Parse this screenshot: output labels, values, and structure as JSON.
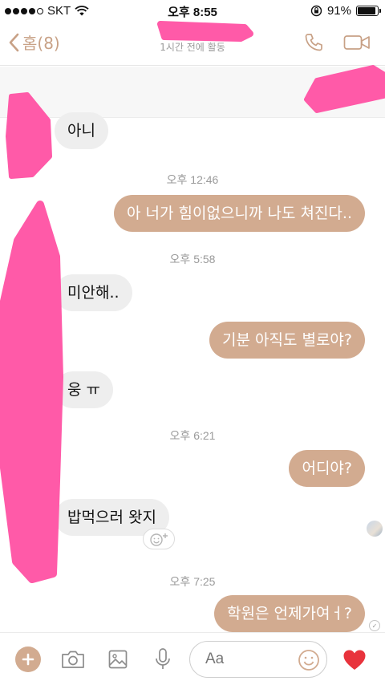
{
  "status_bar": {
    "carrier": "SKT",
    "time": "오후 8:55",
    "battery": "91%",
    "battery_level": 0.91
  },
  "nav": {
    "back_label": "홈(8)",
    "subtitle": "1시간 전에 활동"
  },
  "messages": [
    {
      "type": "incoming",
      "text": "아니"
    },
    {
      "type": "timestamp",
      "text": "오후 12:46"
    },
    {
      "type": "outgoing",
      "text": "아 너가 힘이없으니까 나도 쳐진다.."
    },
    {
      "type": "timestamp",
      "text": "오후 5:58"
    },
    {
      "type": "incoming",
      "text": "미안해.."
    },
    {
      "type": "outgoing",
      "text": "기분 아직도 별로야?"
    },
    {
      "type": "incoming",
      "text": "웅 ㅠ"
    },
    {
      "type": "timestamp",
      "text": "오후 6:21"
    },
    {
      "type": "outgoing",
      "text": "어디야?"
    },
    {
      "type": "incoming",
      "text": "밥먹으러 왓지"
    },
    {
      "type": "timestamp",
      "text": "오후 7:25"
    },
    {
      "type": "outgoing",
      "text": "학원은 언제가여ㅓ?"
    }
  ],
  "composer": {
    "placeholder": "Aa"
  },
  "colors": {
    "accent": "#d2ab90",
    "incoming_bubble": "#eeeeee",
    "redaction": "#ff5aa8",
    "like_heart": "#e8333c"
  },
  "icons": [
    "signal-dots-icon",
    "wifi-icon",
    "lock-rotation-icon",
    "battery-icon",
    "back-chevron-icon",
    "phone-icon",
    "video-icon",
    "add-reaction-icon",
    "plus-icon",
    "camera-icon",
    "image-icon",
    "microphone-icon",
    "emoji-icon",
    "heart-icon",
    "seen-check-icon"
  ]
}
